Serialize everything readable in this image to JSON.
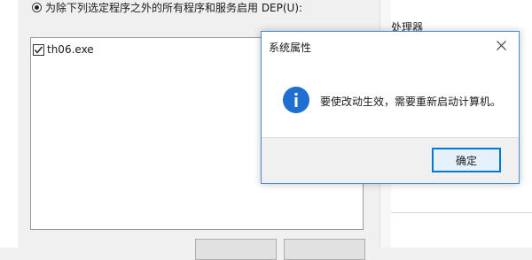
{
  "dep_panel": {
    "radio_label": "为除下列选定程序之外的所有程序和服务启用 DEP(U):",
    "programs": [
      {
        "label": "th06.exe",
        "checked": true
      }
    ]
  },
  "background_window": {
    "processor_label": "处理器"
  },
  "message_box": {
    "title": "系统属性",
    "message": "要使改动生效，需要重新启动计算机。",
    "ok_label": "确定",
    "icon": "info-icon",
    "close_icon": "close-icon"
  },
  "colors": {
    "info_icon": "#1e6fcf",
    "ok_border": "#0078d7",
    "msgbox_border": "#4a90d9"
  }
}
